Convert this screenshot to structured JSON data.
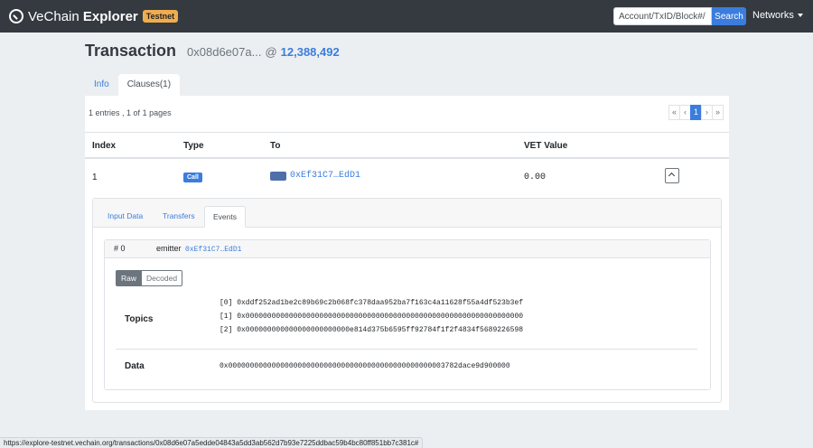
{
  "navbar": {
    "brand_prefix": "VeChain ",
    "brand_bold": "Explorer",
    "badge": "Testnet",
    "search_placeholder": "Account/TxID/Block#/",
    "search_button": "Search",
    "networks_label": "Networks"
  },
  "header": {
    "title": "Transaction",
    "tx_id": "0x08d6e07a...",
    "at": "@",
    "block": "12,388,492"
  },
  "tabs": [
    {
      "label": "Info"
    },
    {
      "label": "Clauses(1)"
    }
  ],
  "pagination": {
    "summary_count": "1",
    "summary_mid": " entries , ",
    "summary_page": "1",
    "summary_of": " of ",
    "summary_total": "1",
    "summary_end": " pages",
    "first": "«",
    "prev": "‹",
    "current": "1",
    "next": "›",
    "last": "»"
  },
  "table": {
    "headers": [
      "Index",
      "Type",
      "To",
      "VET Value"
    ],
    "row": {
      "index": "1",
      "type": "Call",
      "to": "0xEf31C7…EdD1",
      "value": "0.00"
    }
  },
  "detail": {
    "tabs": [
      "Input Data",
      "Transfers",
      "Events"
    ],
    "event": {
      "num": "# 0",
      "emitter_label": "emitter",
      "emitter_addr": "0xEf31C7…EdD1",
      "buttons": [
        "Raw",
        "Decoded"
      ],
      "topics_label": "Topics",
      "topics": [
        "[0] 0xddf252ad1be2c89b69c2b068fc378daa952ba7f163c4a11628f55a4df523b3ef",
        "[1] 0x0000000000000000000000000000000000000000000000000000000000000000",
        "[2] 0x000000000000000000000000e814d375b6595ff92784f1f2f4834f5689226598"
      ],
      "data_label": "Data",
      "data": "0x00000000000000000000000000000000000000000000000003782dace9d900000"
    }
  },
  "status_url": "https://explore-testnet.vechain.org/transactions/0x08d6e07a5edde04843a5dd3ab562d7b93e7225ddbac59b4bc80ff851bb7c381c#",
  "colors": {
    "navbar": "#343a40",
    "accent": "#3b7ddd",
    "badge": "#f0ad4e",
    "background": "#eceff1"
  }
}
